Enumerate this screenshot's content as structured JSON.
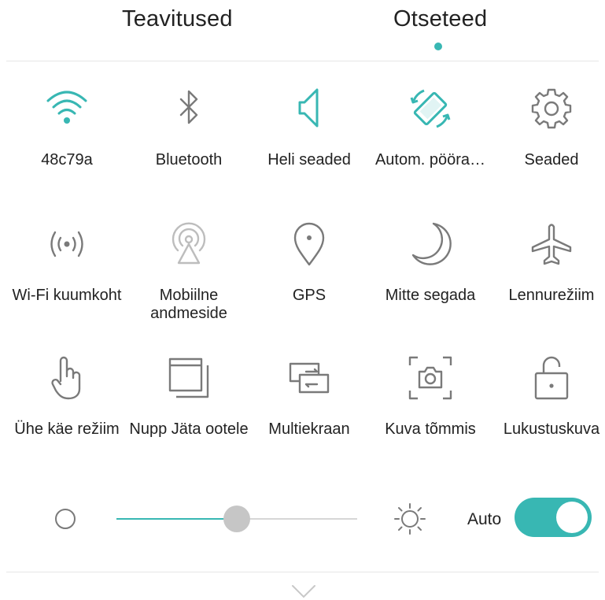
{
  "tabs": [
    {
      "label": "Teavitused",
      "active": false
    },
    {
      "label": "Otseteed",
      "active": true
    }
  ],
  "accent_color": "#38b7b3",
  "shortcuts": [
    {
      "label": "48c79a",
      "icon": "wifi-icon",
      "active": true
    },
    {
      "label": "Bluetooth",
      "icon": "bluetooth-icon",
      "active": false
    },
    {
      "label": "Heli seaded",
      "icon": "speaker-icon",
      "active": true
    },
    {
      "label": "Autom. pööra…",
      "icon": "auto-rotate-icon",
      "active": true
    },
    {
      "label": "Seaded",
      "icon": "gear-icon",
      "active": false
    },
    {
      "label": "Wi-Fi kuumkoht",
      "icon": "hotspot-icon",
      "active": false
    },
    {
      "label": "Mobiilne andmeside",
      "icon": "mobile-data-icon",
      "active": false
    },
    {
      "label": "GPS",
      "icon": "location-pin-icon",
      "active": false
    },
    {
      "label": "Mitte segada",
      "icon": "moon-icon",
      "active": false
    },
    {
      "label": "Lennurežiim",
      "icon": "airplane-icon",
      "active": false
    },
    {
      "label": "Ühe käe režiim",
      "icon": "hand-icon",
      "active": false
    },
    {
      "label": "Nupp Jäta ootele",
      "icon": "stacked-windows-icon",
      "active": false
    },
    {
      "label": "Multiekraan",
      "icon": "multi-screen-icon",
      "active": false
    },
    {
      "label": "Kuva tõmmis",
      "icon": "screenshot-icon",
      "active": false
    },
    {
      "label": "Lukustuskuva",
      "icon": "padlock-icon",
      "active": false
    }
  ],
  "brightness": {
    "level": 0.5,
    "auto_label": "Auto",
    "auto_enabled": true,
    "min_icon": "dim-circle-icon",
    "max_icon": "sun-icon"
  },
  "footer": {
    "icon": "chevron-down-icon"
  }
}
